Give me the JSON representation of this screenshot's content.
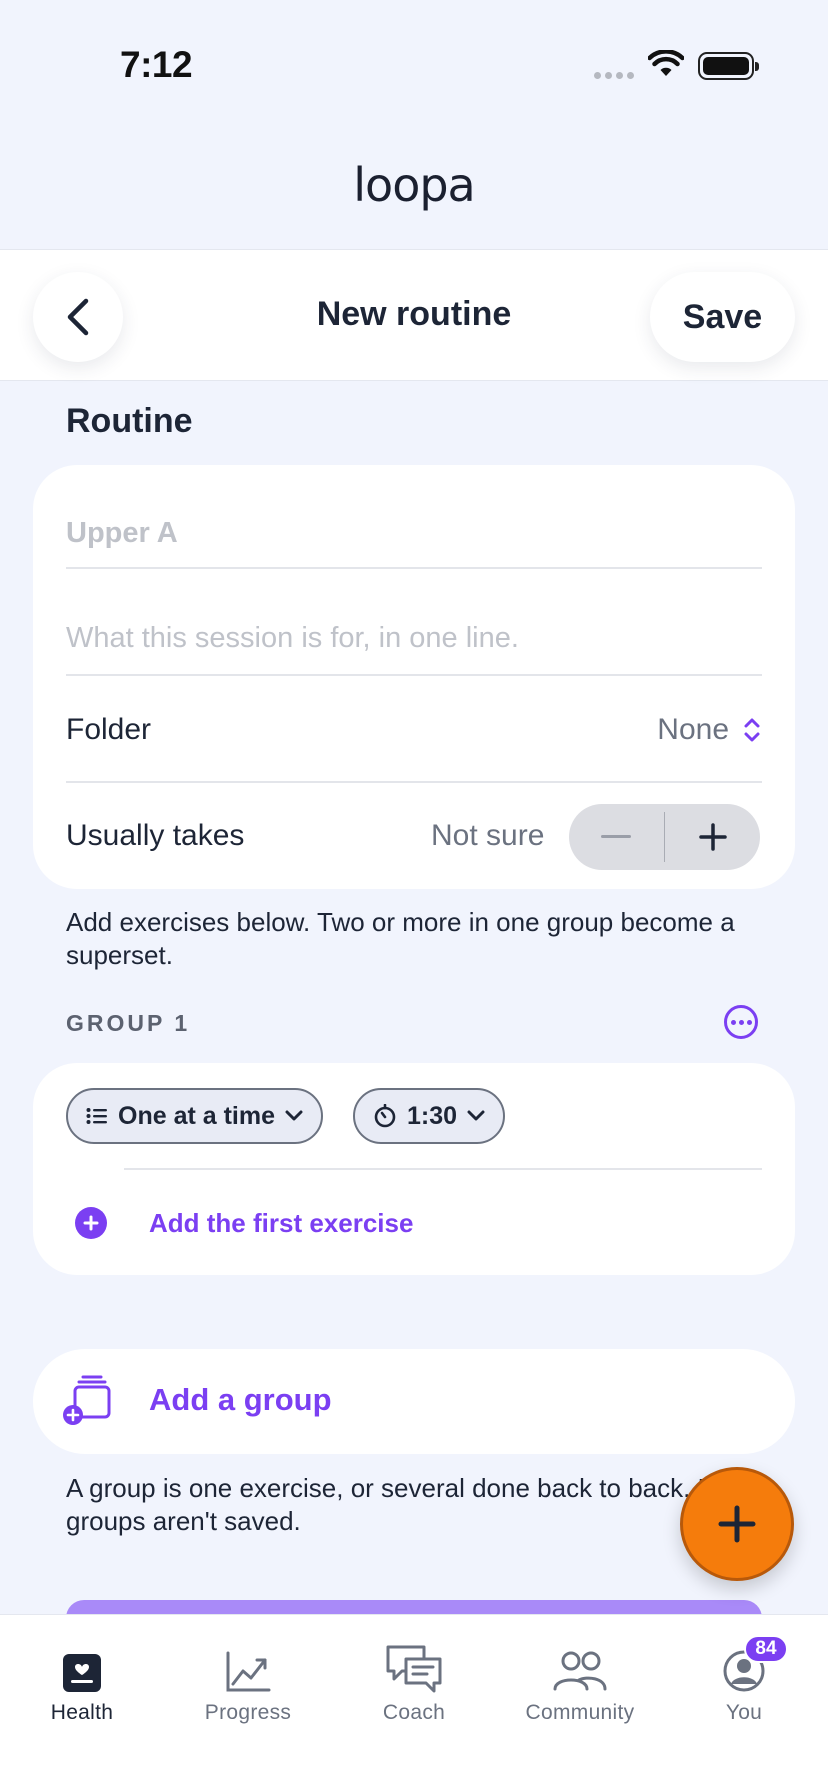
{
  "status_bar": {
    "time": "7:12"
  },
  "app": {
    "logo": "loopa"
  },
  "nav": {
    "title": "New routine",
    "save_label": "Save"
  },
  "routine": {
    "section_title": "Routine",
    "name_placeholder": "Upper A",
    "description_placeholder": "What this session is for, in one line.",
    "folder_label": "Folder",
    "folder_value": "None",
    "duration_label": "Usually takes",
    "duration_value": "Not sure",
    "helper_text": "Add exercises below. Two or more in one group become a superset."
  },
  "group": {
    "label": "GROUP 1",
    "mode_pill": "One at a time",
    "rest_pill": "1:30",
    "add_exercise_label": "Add the first exercise"
  },
  "add_group": {
    "label": "Add a group",
    "helper_text": "A group is one exercise, or several done back to back. Empty groups aren't saved."
  },
  "colors": {
    "accent": "#7b3ff2",
    "fab": "#f57c0c",
    "background": "#f1f4fd"
  },
  "tabs": [
    {
      "label": "Health",
      "icon": "health-icon",
      "active": true
    },
    {
      "label": "Progress",
      "icon": "chart-icon",
      "active": false
    },
    {
      "label": "Coach",
      "icon": "chat-icon",
      "active": false
    },
    {
      "label": "Community",
      "icon": "people-icon",
      "active": false
    },
    {
      "label": "You",
      "icon": "profile-icon",
      "active": false,
      "badge": "84"
    }
  ]
}
